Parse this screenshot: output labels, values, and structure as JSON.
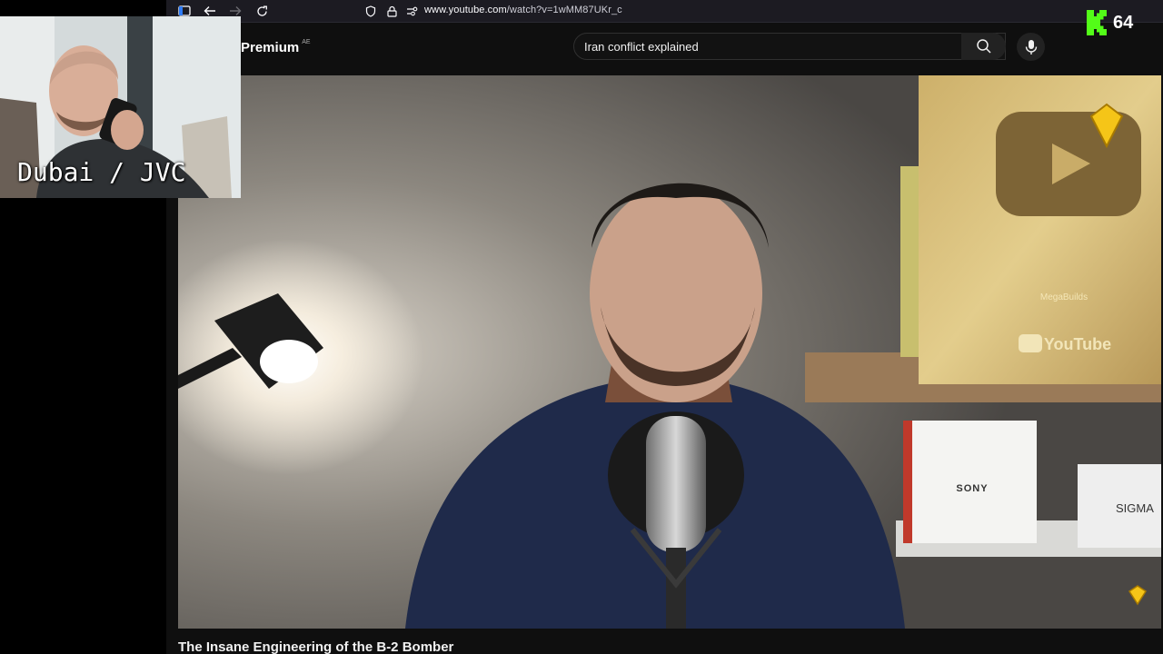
{
  "browser": {
    "url_host": "www.youtube.com",
    "url_path": "/watch?v=1wMM87UKr_c"
  },
  "youtube": {
    "logo_text": "Premium",
    "region": "AE",
    "search_value": "Iran conflict explained",
    "video_title": "The Insane Engineering of the B-2 Bomber"
  },
  "kick": {
    "viewer_count": "64"
  },
  "webcam": {
    "label": "Dubai / JVC"
  },
  "video_props": {
    "box_brand_1": "SONY",
    "box_brand_2": "SIGMA",
    "plaque_brand": "YouTube",
    "plaque_name": "MegaBuilds"
  },
  "colors": {
    "kick_green": "#53fc18",
    "gem_gold": "#f5c518"
  }
}
